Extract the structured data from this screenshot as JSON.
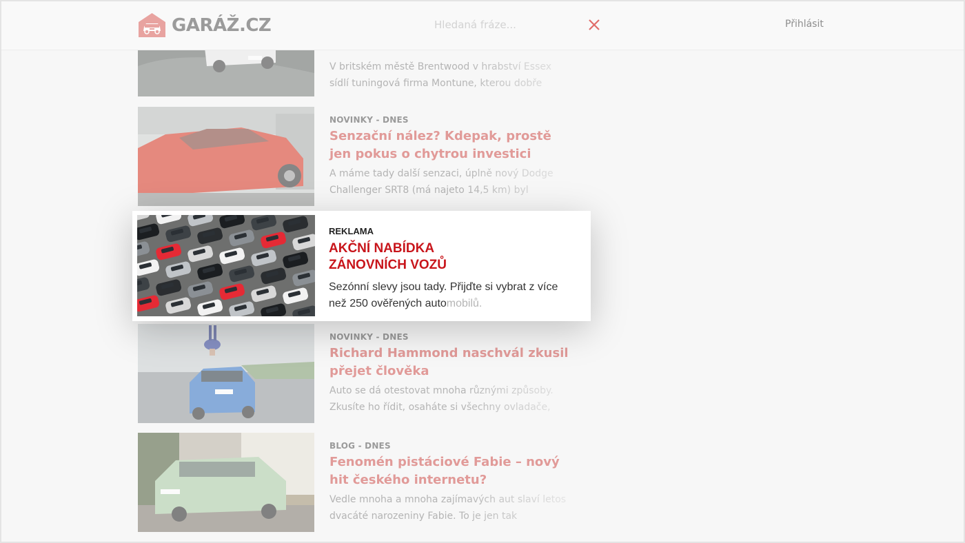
{
  "header": {
    "logo_text": "GARÁŽ.CZ",
    "search_placeholder": "Hledaná fráze...",
    "login_label": "Přihlásit",
    "close_icon": "close-icon"
  },
  "colors": {
    "accent": "#e8837f",
    "ad_red": "#c8151b"
  },
  "articles": [
    {
      "category": "",
      "title": "",
      "description": "V britském městě Brentwood v hrabství Essex sídlí tuningová firma Montune, kterou dobře"
    },
    {
      "category": "NOVINKY - DNES",
      "title": "Senzační nález? Kdepak, prostě jen pokus o chytrou investici",
      "description": "A máme tady další senzaci, úplně nový Dodge Challenger SRT8 (má najeto 14,5 km) byl"
    },
    {
      "category": "NOVINKY - DNES",
      "title": "Richard Hammond naschvál zkusil přejet člověka",
      "description": "Auto se dá otestovat mnoha různými způsoby. Zkusíte ho řídit, osaháte si všechny ovladače,"
    },
    {
      "category": "BLOG - DNES",
      "title": "Fenomén pistáciové Fabie – nový hit českého internetu?",
      "description": "Vedle mnoha a mnoha zajímavých aut slaví letos dvacáté narozeniny Fabie. To je jen tak"
    }
  ],
  "ad": {
    "label": "REKLAMA",
    "title": "AKČNÍ NABÍDKA\nZÁNOVNÍCH VOZŮ",
    "description": "Sezónní slevy jsou tady. Přijďte si vybrat z více než 250 ověřených auto",
    "description_fade": "mobilů."
  }
}
